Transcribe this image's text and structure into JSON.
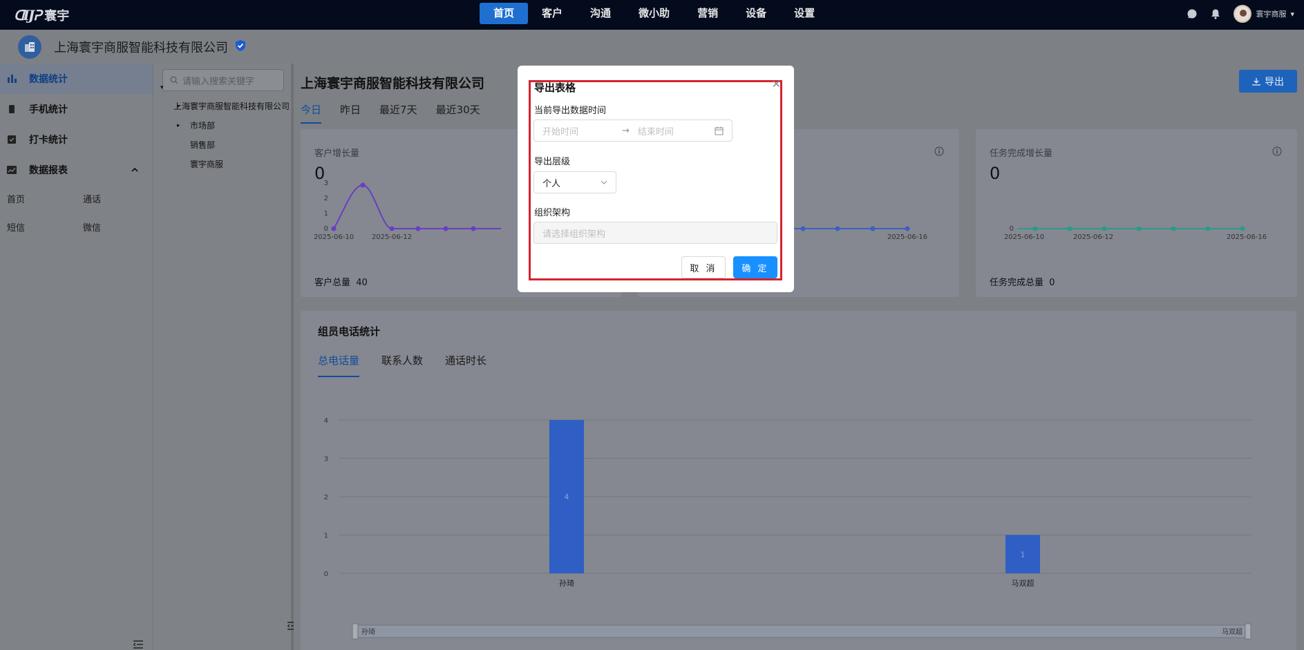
{
  "topnav": {
    "logo_text": "寰宇",
    "items": [
      "首页",
      "客户",
      "沟通",
      "微小助",
      "营销",
      "设备",
      "设置"
    ],
    "active_index": 0,
    "username": "寰宇商服"
  },
  "company": {
    "name": "上海寰宇商服智能科技有限公司"
  },
  "sidebar": {
    "items": [
      "数据统计",
      "手机统计",
      "打卡统计",
      "数据报表"
    ],
    "sub_items": [
      "首页",
      "通话",
      "短信",
      "微信"
    ]
  },
  "tree": {
    "search_placeholder": "请输入搜索关键字",
    "root": "上海寰宇商服智能科技有限公司",
    "children": [
      "市场部",
      "销售部",
      "寰宇商服"
    ]
  },
  "main": {
    "title": "上海寰宇商服智能科技有限公司",
    "date_tabs": [
      "今日",
      "昨日",
      "最近7天",
      "最近30天"
    ],
    "export_label": "导出",
    "cards": [
      {
        "label": "客户增长量",
        "value": "0",
        "total_label": "客户总量",
        "total_value": "40",
        "x_ticks": [
          "2025-06-10",
          "2025-06-12"
        ],
        "y_ticks": [
          "0",
          "1",
          "2",
          "3"
        ]
      },
      {
        "label": "",
        "value": "",
        "total_label": "",
        "total_value": "",
        "x_ticks": [
          "2025-06-16"
        ]
      },
      {
        "label": "任务完成增长量",
        "value": "0",
        "total_label": "任务完成总量",
        "total_value": "0",
        "x_ticks": [
          "2025-06-10",
          "2025-06-12",
          "2025-06-16"
        ],
        "y_ticks": [
          "0"
        ]
      }
    ],
    "section_title": "组员电话统计",
    "section_tabs": [
      "总电话量",
      "联系人数",
      "通话时长"
    ]
  },
  "chart_data": {
    "type": "bar",
    "categories": [
      "孙琦",
      "马双超"
    ],
    "values": [
      4,
      1
    ],
    "ylim": [
      0,
      4
    ],
    "y_ticks": [
      0,
      1,
      2,
      3,
      4
    ],
    "grid": true,
    "zoom_labels": [
      "孙琦",
      "马双超"
    ],
    "bar_color": "#2f5fc4"
  },
  "modal": {
    "title": "导出表格",
    "time_label": "当前导出数据时间",
    "start_placeholder": "开始时间",
    "end_placeholder": "结束时间",
    "level_label": "导出层级",
    "level_value": "个人",
    "org_label": "组织架构",
    "org_placeholder": "请选择组织架构",
    "cancel": "取 消",
    "ok": "确 定"
  }
}
